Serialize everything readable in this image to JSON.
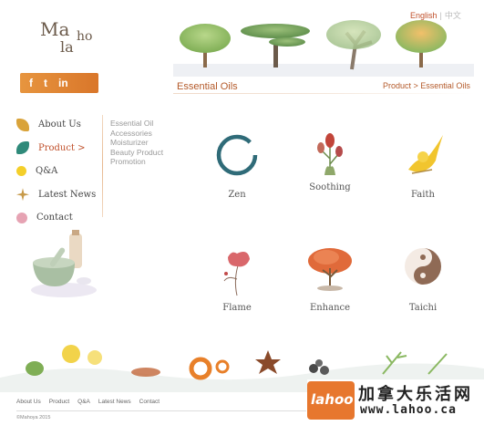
{
  "logo": {
    "line1": "Ma",
    "line2": "la",
    "line3": "ho"
  },
  "social": {
    "facebook": "f",
    "twitter": "t",
    "linkedin": "in"
  },
  "language": {
    "english": "English",
    "separator": "|",
    "chinese": "中文"
  },
  "header": {
    "section_title": "Essential Oils",
    "breadcrumb_parent": "Product",
    "breadcrumb_sep": " > ",
    "breadcrumb_current": "Essential Oils"
  },
  "main_nav": [
    {
      "label": "About Us",
      "icon": "leaf-icon",
      "color": "#d9a33a"
    },
    {
      "label": "Product >",
      "icon": "leaf-icon",
      "color": "#2f8a7a",
      "active": true
    },
    {
      "label": "Q&A",
      "icon": "dot-icon",
      "color": "#f4cf2a"
    },
    {
      "label": "Latest News",
      "icon": "star-leaf-icon",
      "color": "#c79a4a"
    },
    {
      "label": "Contact",
      "icon": "flower-icon",
      "color": "#e6a3b3"
    }
  ],
  "sub_nav": [
    "Essential Oil",
    "Accessories",
    "Moisturizer",
    "Beauty Product",
    "Promotion"
  ],
  "products": [
    {
      "label": "Zen",
      "icon": "enso-icon"
    },
    {
      "label": "Soothing",
      "icon": "tulip-icon"
    },
    {
      "label": "Faith",
      "icon": "yellow-bird-icon"
    },
    {
      "label": "Flame",
      "icon": "red-flower-icon"
    },
    {
      "label": "Enhance",
      "icon": "red-tree-icon"
    },
    {
      "label": "Taichi",
      "icon": "yin-yang-icon"
    }
  ],
  "footer": {
    "nav": [
      "About Us",
      "Product",
      "Q&A",
      "Latest News",
      "Contact"
    ],
    "copyright": "©Mahoya 2015"
  },
  "watermark": {
    "logo_text": "lahoo",
    "chinese": "加拿大乐活网",
    "url": "www.lahoo.ca"
  },
  "colors": {
    "accent": "#c0502b",
    "social_bar": "#e08a35"
  }
}
